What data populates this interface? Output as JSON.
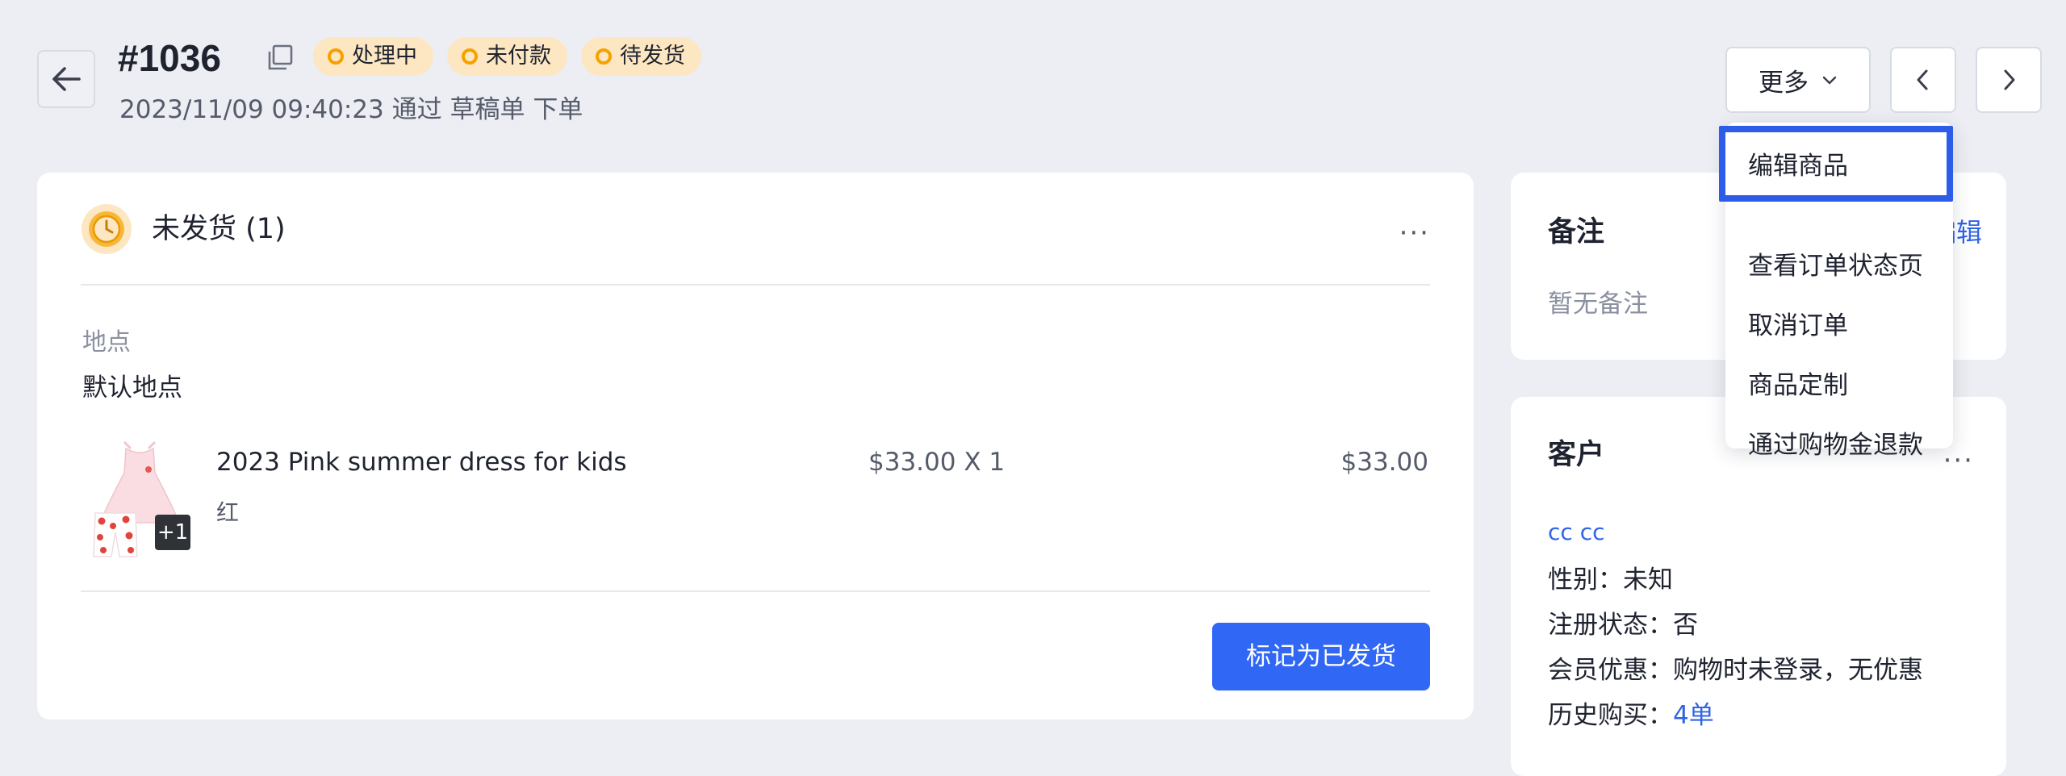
{
  "header": {
    "order_number": "#1036",
    "badges": [
      "处理中",
      "未付款",
      "待发货"
    ],
    "subline": "2023/11/09 09:40:23 通过 草稿单 下单",
    "more_label": "更多"
  },
  "dropdown": {
    "items": [
      "编辑商品",
      "查看订单状态页",
      "取消订单",
      "商品定制",
      "通过购物金退款"
    ]
  },
  "fulfillment": {
    "title": "未发货 (1)",
    "location_label": "地点",
    "location_value": "默认地点",
    "product": {
      "name": "2023 Pink summer dress for kids",
      "variant": "红",
      "extra_count": "+1",
      "unit_price": "$33.00 X 1",
      "total": "$33.00"
    },
    "action_label": "标记为已发货"
  },
  "notes": {
    "title": "备注",
    "edit_label": "编辑",
    "empty_text": "暂无备注"
  },
  "customer": {
    "title": "客户",
    "name": "cc cc",
    "gender": "性别：未知",
    "registration": "注册状态：否",
    "member_discount": "会员优惠：购物时未登录，无优惠",
    "history_label": "历史购买：",
    "history_link": "4单"
  },
  "colors": {
    "primary": "#3067f5",
    "link": "#2f63e8",
    "badge_bg": "#fde7c2",
    "badge_dot": "#f5a100",
    "page_bg": "#eceef3"
  }
}
